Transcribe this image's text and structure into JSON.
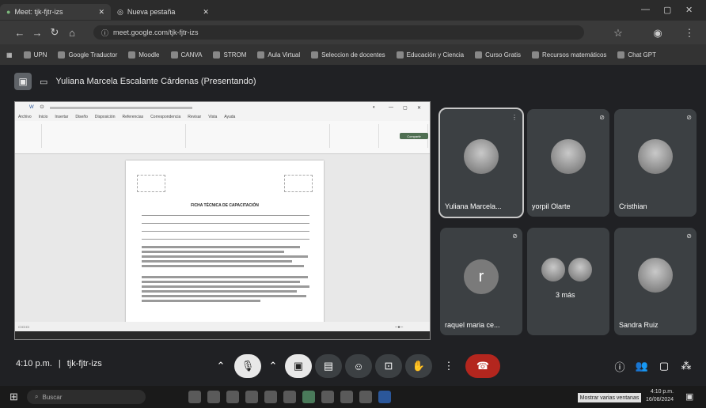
{
  "browser": {
    "tabs": [
      {
        "label": "Meet: tjk-fjtr-izs",
        "active": true
      },
      {
        "label": "Nueva pestaña",
        "active": false
      }
    ],
    "url": "meet.google.com/tjk-fjtr-izs",
    "bookmarks": [
      "UPN",
      "Google Traductor",
      "Moodle",
      "CANVA",
      "STROM",
      "Aula Virtual",
      "Seleccion de docentes",
      "Educación y Ciencia",
      "Curso Gratis",
      "Recursos matemáticos",
      "Chat GPT"
    ]
  },
  "meet": {
    "presenter_label": "Yuliana Marcela Escalante Cárdenas (Presentando)",
    "shared_doc": {
      "heading": "FICHA TÉCNICA DE CAPACITACIÓN",
      "menu": [
        "Archivo",
        "Inicio",
        "Insertar",
        "Diseño",
        "Disposición",
        "Referencias",
        "Correspondencia",
        "Revisar",
        "Vista",
        "Ayuda"
      ],
      "share_label": "Compartir"
    },
    "participants": [
      {
        "name": "Yuliana Marcela...",
        "type": "photo",
        "active": true
      },
      {
        "name": "yorpil Olarte",
        "type": "photo",
        "active": false
      },
      {
        "name": "Cristhian",
        "type": "photo",
        "active": false
      },
      {
        "name": "raquel maria ce...",
        "type": "letter",
        "letter": "r",
        "active": false
      },
      {
        "name": "3 más",
        "type": "group",
        "active": false
      },
      {
        "name": "Sandra Ruiz",
        "type": "photo",
        "active": false
      }
    ],
    "controls": {
      "time": "4:10 p.m.",
      "meeting_code": "tjk-fjtr-izs"
    }
  },
  "taskbar": {
    "search_placeholder": "Buscar",
    "tooltip": "Mostrar varias ventanas",
    "time": "4:10 p.m.",
    "date": "16/08/2024"
  }
}
